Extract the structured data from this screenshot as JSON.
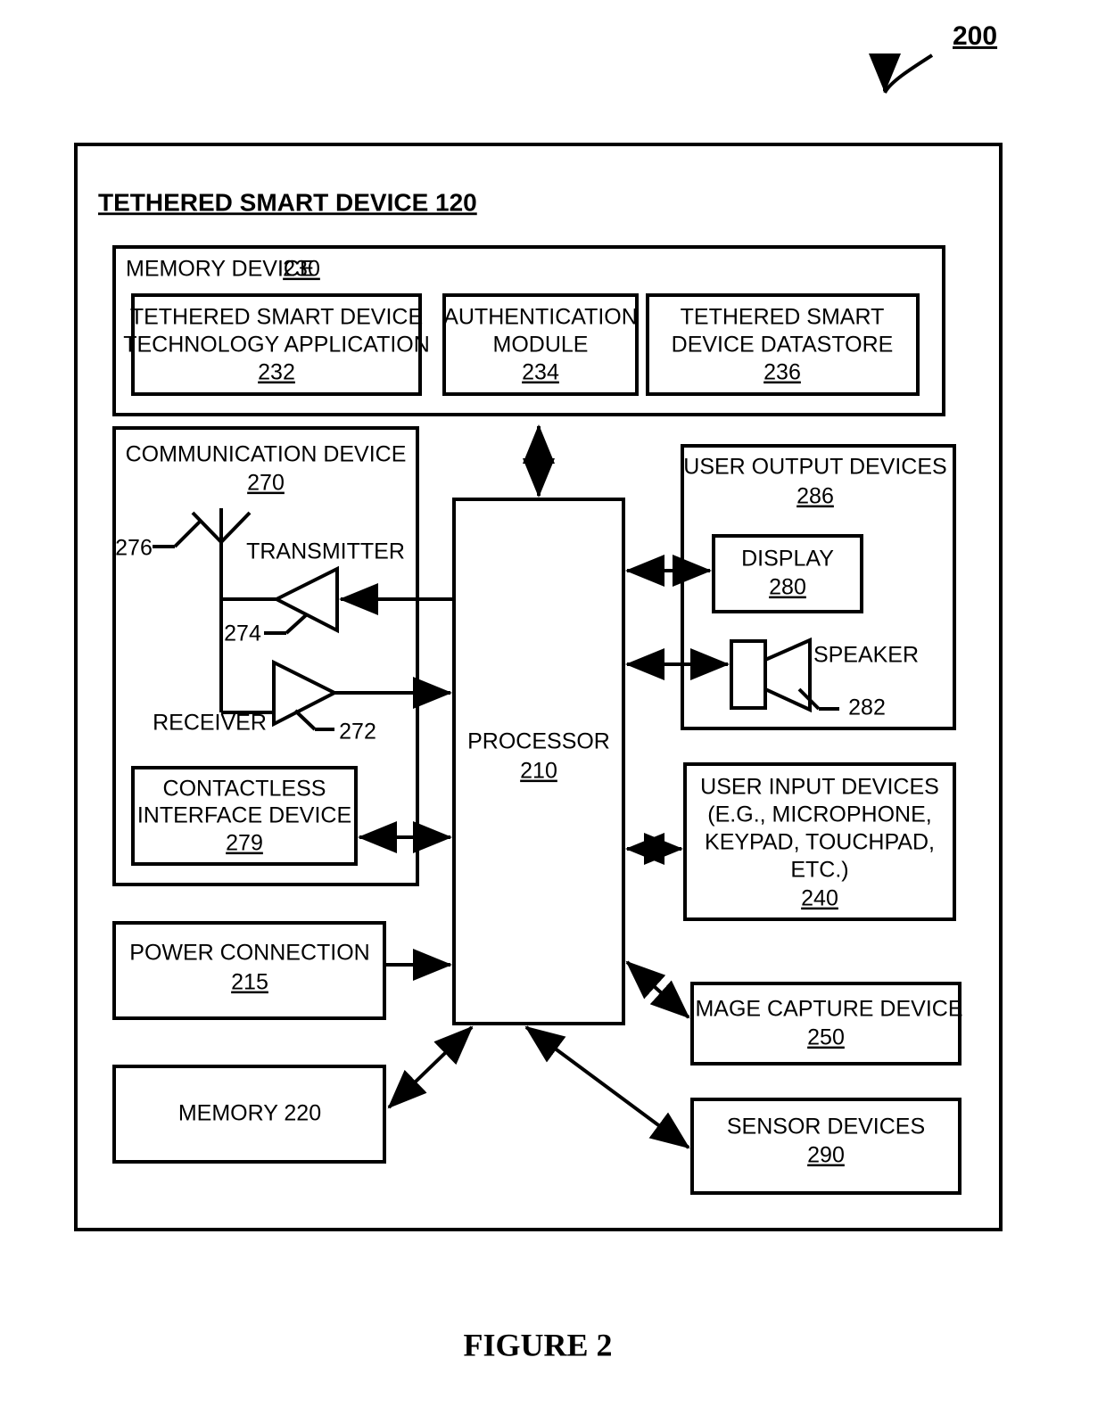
{
  "figure": {
    "top_reference": "200",
    "caption": "FIGURE 2"
  },
  "outer": {
    "title": "TETHERED SMART DEVICE 120"
  },
  "memory_device": {
    "label": "MEMORY DEVICE",
    "ref": "230",
    "modules": [
      {
        "line1": "TETHERED SMART DEVICE",
        "line2": "TECHNOLOGY APPLICATION",
        "ref": "232"
      },
      {
        "line1": "AUTHENTICATION",
        "line2": "MODULE",
        "ref": "234"
      },
      {
        "line1": "TETHERED SMART",
        "line2": "DEVICE DATASTORE",
        "ref": "236"
      }
    ]
  },
  "communication_device": {
    "label": "COMMUNICATION DEVICE",
    "ref": "270",
    "antenna_ref": "276",
    "transmitter_label": "TRANSMITTER",
    "transmitter_ref": "274",
    "receiver_label": "RECEIVER",
    "receiver_ref": "272",
    "contactless": {
      "line1": "CONTACTLESS",
      "line2": "INTERFACE DEVICE",
      "ref": "279"
    }
  },
  "processor": {
    "label": "PROCESSOR",
    "ref": "210"
  },
  "user_output_devices": {
    "label": "USER OUTPUT DEVICES",
    "ref": "286",
    "display": {
      "label": "DISPLAY",
      "ref": "280"
    },
    "speaker": {
      "label": "SPEAKER",
      "ref": "282"
    }
  },
  "user_input_devices": {
    "line1": "USER INPUT DEVICES",
    "line2": "(E.G., MICROPHONE,",
    "line3": "KEYPAD, TOUCHPAD,",
    "line4": "ETC.)",
    "ref": "240"
  },
  "power_connection": {
    "label": "POWER CONNECTION",
    "ref": "215"
  },
  "memory": {
    "label": "MEMORY 220"
  },
  "image_capture_device": {
    "label": "IMAGE CAPTURE DEVICE",
    "ref": "250"
  },
  "sensor_devices": {
    "label": "SENSOR DEVICES",
    "ref": "290"
  },
  "colors": {
    "ink": "#000000",
    "paper": "#ffffff"
  }
}
